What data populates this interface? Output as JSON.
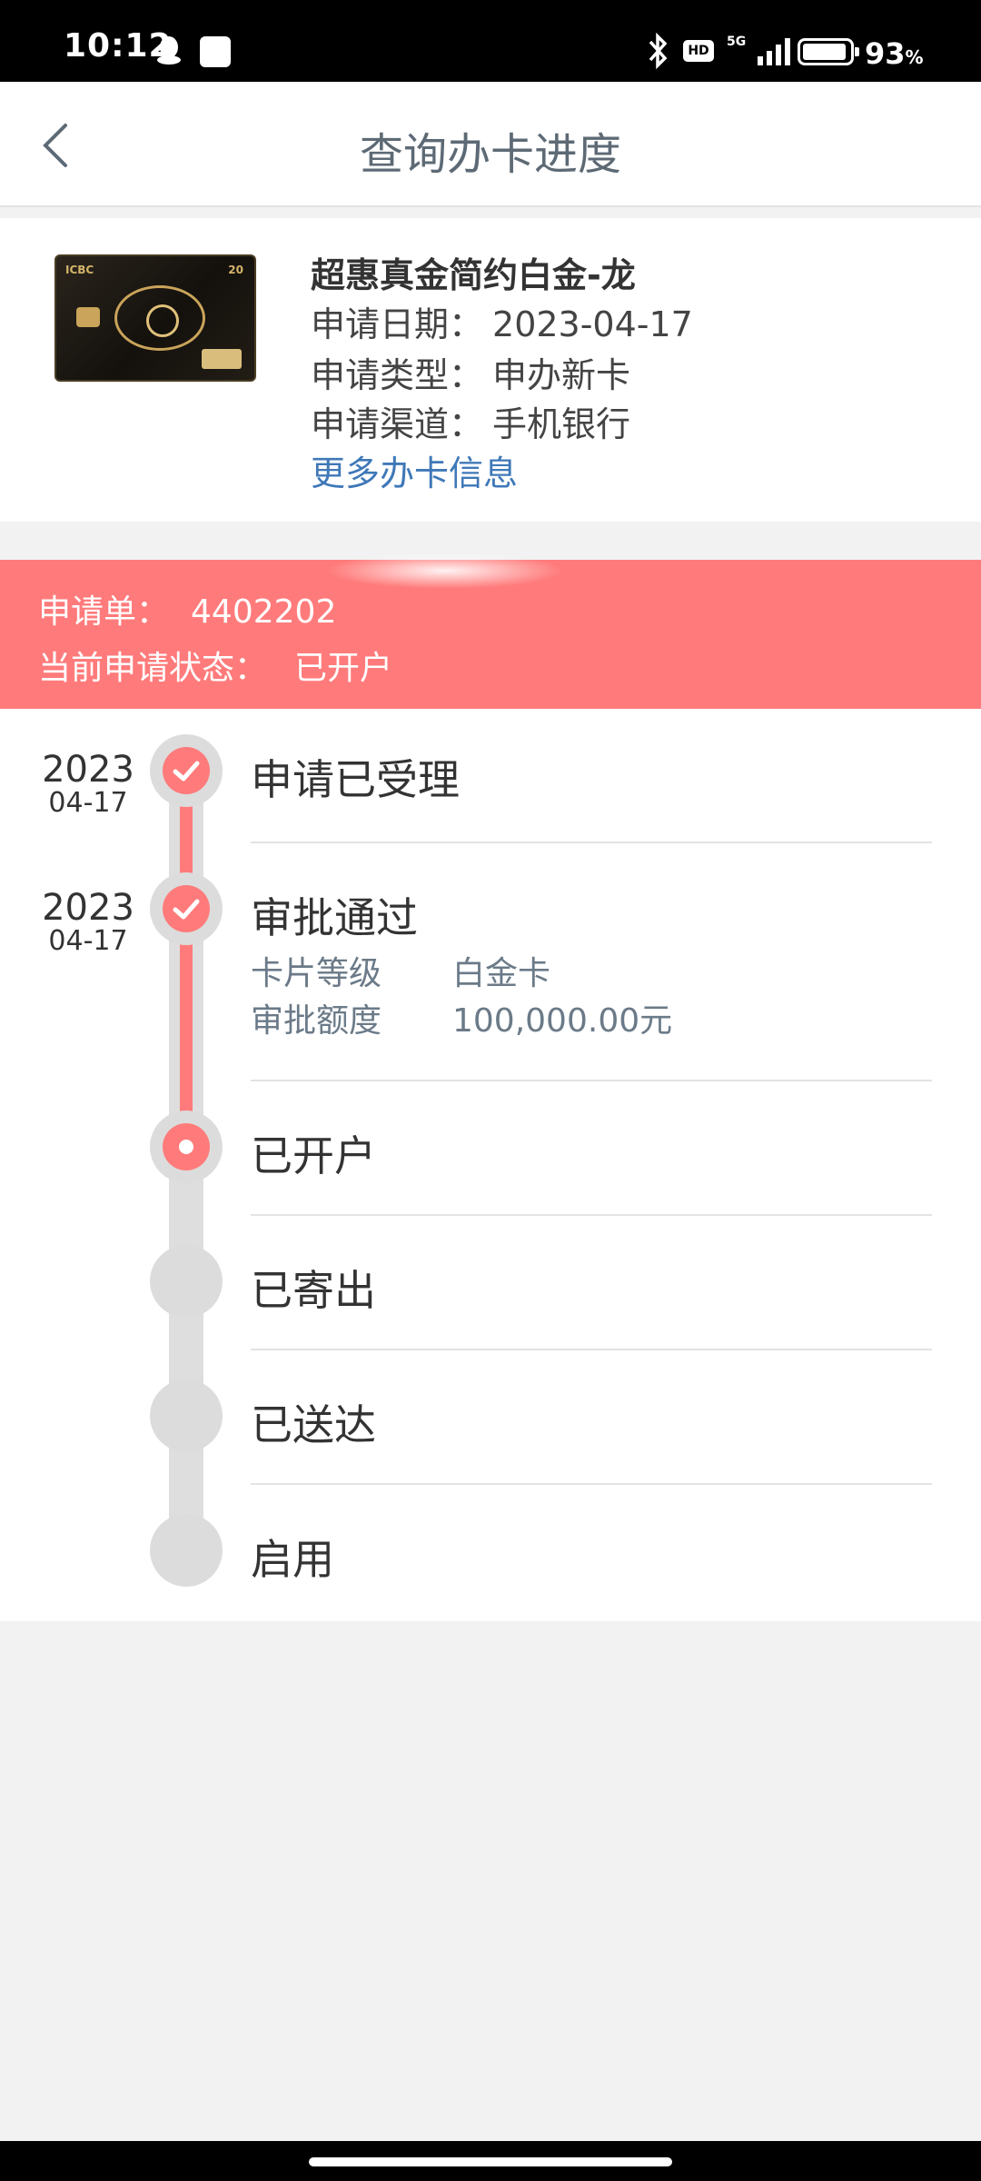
{
  "status_bar": {
    "time": "10:12",
    "network": "5G",
    "hd_badge": "HD",
    "battery_percent": "93",
    "battery_unit": "%"
  },
  "header": {
    "title": "查询办卡进度"
  },
  "card": {
    "name": "超惠真金简约白金-龙",
    "image_brand": "ICBC",
    "image_number": "20",
    "lines": [
      {
        "label": "申请日期：",
        "value": "2023-04-17"
      },
      {
        "label": "申请类型：",
        "value": "申办新卡"
      },
      {
        "label": "申请渠道：",
        "value": "手机银行"
      }
    ],
    "more_link": "更多办卡信息"
  },
  "banner": {
    "app_label": "申请单：",
    "app_number": "4402202",
    "status_label": "当前申请状态：",
    "status_value": "已开户",
    "color": "#ff7b7b"
  },
  "timeline": {
    "steps": [
      {
        "title": "申请已受理",
        "year": "2023",
        "date": "04-17",
        "state": "done"
      },
      {
        "title": "审批通过",
        "year": "2023",
        "date": "04-17",
        "state": "done",
        "details": [
          {
            "key": "卡片等级",
            "value": "白金卡"
          },
          {
            "key": "审批额度",
            "value": "100,000.00元"
          }
        ]
      },
      {
        "title": "已开户",
        "state": "current"
      },
      {
        "title": "已寄出",
        "state": "pending"
      },
      {
        "title": "已送达",
        "state": "pending"
      },
      {
        "title": "启用",
        "state": "pending"
      }
    ]
  }
}
